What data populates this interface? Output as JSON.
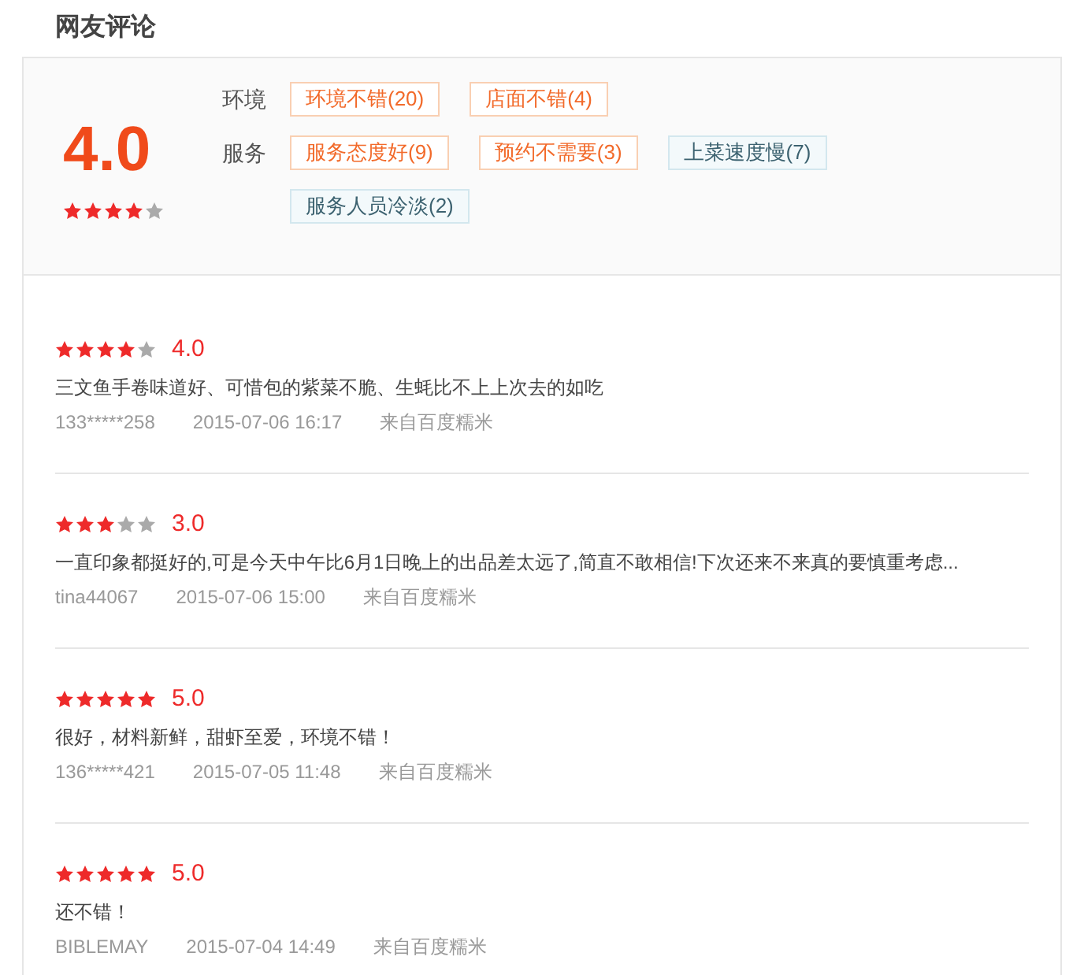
{
  "title": "网友评论",
  "summary": {
    "score": "4.0",
    "stars": 4,
    "groups": [
      {
        "label": "环境",
        "tags": [
          {
            "text": "环境不错(20)",
            "kind": "positive"
          },
          {
            "text": "店面不错(4)",
            "kind": "positive"
          }
        ]
      },
      {
        "label": "服务",
        "tags": [
          {
            "text": "服务态度好(9)",
            "kind": "positive"
          },
          {
            "text": "预约不需要(3)",
            "kind": "positive"
          },
          {
            "text": "上菜速度慢(7)",
            "kind": "negative"
          },
          {
            "text": "服务人员冷淡(2)",
            "kind": "negative"
          }
        ]
      }
    ]
  },
  "reviews": [
    {
      "stars": 4,
      "score": "4.0",
      "text": "三文鱼手卷味道好、可惜包的紫菜不脆、生蚝比不上上次去的如吃",
      "user": "133*****258",
      "time": "2015-07-06 16:17",
      "source": "来自百度糯米"
    },
    {
      "stars": 3,
      "score": "3.0",
      "text": "一直印象都挺好的,可是今天中午比6月1日晚上的出品差太远了,简直不敢相信!下次还来不来真的要慎重考虑...",
      "user": "tina44067",
      "time": "2015-07-06 15:00",
      "source": "来自百度糯米"
    },
    {
      "stars": 5,
      "score": "5.0",
      "text": "很好，材料新鲜，甜虾至爱，环境不错！",
      "user": "136*****421",
      "time": "2015-07-05 11:48",
      "source": "来自百度糯米"
    },
    {
      "stars": 5,
      "score": "5.0",
      "text": "还不错！",
      "user": "BIBLEMAY",
      "time": "2015-07-04 14:49",
      "source": "来自百度糯米"
    }
  ]
}
